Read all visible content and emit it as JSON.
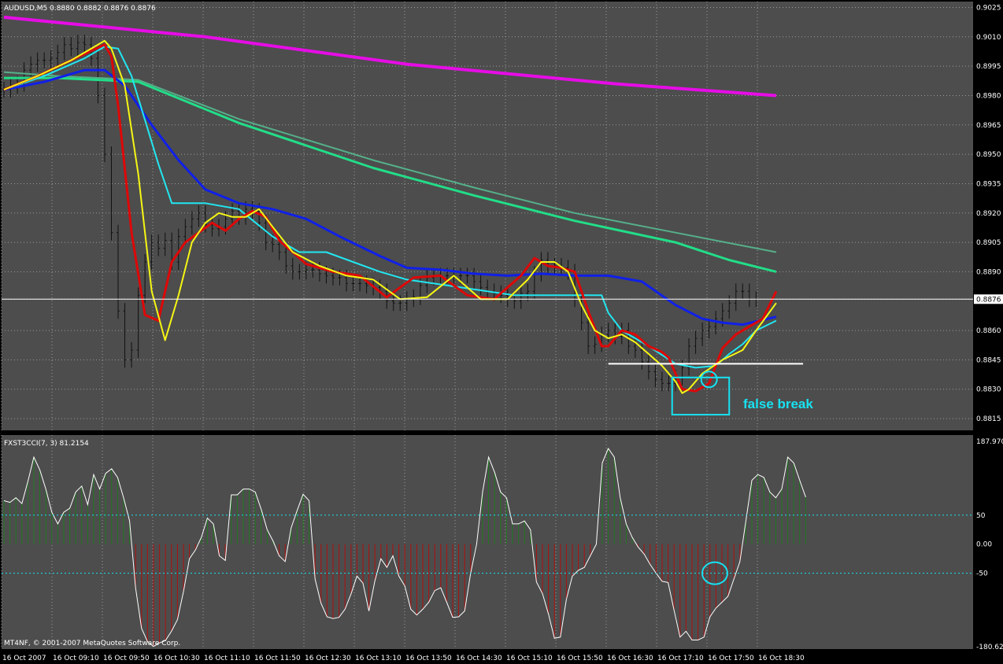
{
  "colors": {
    "background": "#4d4d4d",
    "frame": "#000000",
    "grid": "#9a9a9a",
    "text": "#ffffff",
    "bull_hist": "#1f7a1f",
    "bear_hist": "#b01010",
    "annotation": "#17e2f2",
    "ma_magenta": "#e60ce6",
    "ma_green": "#22dd88",
    "ma_green_thin": "#55b08a",
    "ma_blue": "#1020e8",
    "ma_cyan": "#22e6f0",
    "ma_red": "#dd0808",
    "ma_yellow": "#f6f614"
  },
  "chart_data": [
    {
      "type": "line",
      "header": "AUDUSD,M5  0.8880 0.8882 0.8876 0.8876",
      "symbol": "AUDUSD",
      "timeframe": "M5",
      "ylim": [
        0.8809,
        0.9028
      ],
      "y_ticks": [
        "0.9025",
        "0.9010",
        "0.8995",
        "0.8980",
        "0.8965",
        "0.8950",
        "0.8935",
        "0.8920",
        "0.8905",
        "0.8890",
        "0.8876",
        "0.8860",
        "0.8845",
        "0.8830",
        "0.8815"
      ],
      "current_price": "0.8876",
      "bar_count": 117,
      "close": [
        0.8983,
        0.8985,
        0.8986,
        0.8993,
        0.8996,
        0.8998,
        0.8998,
        0.8999,
        0.9002,
        0.9006,
        0.9004,
        0.9007,
        0.9006,
        0.8999,
        0.898,
        0.895,
        0.891,
        0.887,
        0.8845,
        0.885,
        0.8878,
        0.8895,
        0.8905,
        0.8902,
        0.8906,
        0.8895,
        0.8908,
        0.8913,
        0.8917,
        0.892,
        0.8914,
        0.8912,
        0.8913,
        0.8917,
        0.8921,
        0.8918,
        0.8922,
        0.8921,
        0.8915,
        0.8905,
        0.8904,
        0.89,
        0.8893,
        0.889,
        0.889,
        0.8891,
        0.8891,
        0.8889,
        0.8888,
        0.8887,
        0.8887,
        0.8884,
        0.8884,
        0.8884,
        0.8883,
        0.8882,
        0.888,
        0.8875,
        0.8874,
        0.8874,
        0.8876,
        0.8877,
        0.8883,
        0.8887,
        0.8888,
        0.8888,
        0.8888,
        0.8888,
        0.8888,
        0.8888,
        0.8885,
        0.8882,
        0.888,
        0.8879,
        0.8878,
        0.8876,
        0.8875,
        0.8879,
        0.888,
        0.8889,
        0.8896,
        0.8893,
        0.8893,
        0.8892,
        0.889,
        0.8876,
        0.8864,
        0.8852,
        0.8853,
        0.8858,
        0.886,
        0.8857,
        0.886,
        0.8852,
        0.885,
        0.8844,
        0.8839,
        0.8835,
        0.8833,
        0.8833,
        0.8836,
        0.8841,
        0.8852,
        0.8856,
        0.886,
        0.8862,
        0.8866,
        0.887,
        0.8874,
        0.888,
        0.888,
        0.8876,
        0.8876
      ],
      "series": [
        {
          "color_key": "ma_magenta",
          "x": [
            0,
            12,
            30,
            60,
            91,
            115
          ],
          "y": [
            0.902,
            0.9016,
            0.901,
            0.8996,
            0.8986,
            0.898
          ]
        },
        {
          "color_key": "ma_green_thin",
          "x": [
            0,
            8,
            20,
            35,
            55,
            70,
            85,
            100,
            115
          ],
          "y": [
            0.8992,
            0.899,
            0.8988,
            0.8968,
            0.8947,
            0.8933,
            0.892,
            0.891,
            0.89
          ]
        },
        {
          "color_key": "ma_green",
          "x": [
            0,
            8,
            20,
            35,
            55,
            70,
            85,
            100,
            108,
            115
          ],
          "y": [
            0.8989,
            0.8989,
            0.8987,
            0.8966,
            0.8943,
            0.8929,
            0.8916,
            0.8905,
            0.8896,
            0.889
          ]
        },
        {
          "color_key": "ma_blue",
          "x": [
            0,
            6,
            12,
            15,
            18,
            22,
            26,
            30,
            35,
            40,
            45,
            50,
            56,
            60,
            65,
            70,
            75,
            80,
            85,
            90,
            95,
            100,
            104,
            107,
            110,
            115
          ],
          "y": [
            0.8983,
            0.8987,
            0.8993,
            0.8993,
            0.8985,
            0.8965,
            0.8947,
            0.8932,
            0.8925,
            0.8922,
            0.8917,
            0.8908,
            0.8898,
            0.8892,
            0.8891,
            0.8889,
            0.8888,
            0.8889,
            0.8888,
            0.8888,
            0.8885,
            0.8873,
            0.8866,
            0.8864,
            0.8863,
            0.8867
          ]
        },
        {
          "color_key": "ma_cyan",
          "x": [
            0,
            6,
            12,
            15,
            17,
            19,
            23,
            25,
            30,
            35,
            40,
            44,
            48,
            52,
            56,
            60,
            66,
            70,
            76,
            80,
            86,
            89,
            90,
            92,
            96,
            100,
            103,
            106,
            108,
            110,
            112,
            115
          ],
          "y": [
            0.8983,
            0.899,
            0.8999,
            0.9005,
            0.9004,
            0.899,
            0.8945,
            0.8925,
            0.8925,
            0.8922,
            0.8908,
            0.89,
            0.89,
            0.8895,
            0.889,
            0.8886,
            0.8883,
            0.8881,
            0.8878,
            0.8878,
            0.8878,
            0.8878,
            0.8869,
            0.886,
            0.8852,
            0.8843,
            0.8841,
            0.8842,
            0.8848,
            0.8853,
            0.886,
            0.8865
          ]
        },
        {
          "color_key": "ma_red",
          "x": [
            0,
            5,
            10,
            15,
            16,
            17,
            19,
            21,
            23,
            25,
            27,
            29,
            31,
            33,
            35,
            37,
            39,
            41,
            45,
            49,
            53,
            57,
            61,
            65,
            69,
            73,
            77,
            79,
            81,
            83,
            85,
            87,
            89,
            90,
            92,
            94,
            96,
            98,
            99,
            100,
            101,
            103,
            105,
            107,
            109,
            111,
            113,
            115
          ],
          "y": [
            0.8983,
            0.899,
            0.8998,
            0.9006,
            0.9,
            0.8975,
            0.891,
            0.8868,
            0.8865,
            0.8895,
            0.8905,
            0.891,
            0.8915,
            0.8911,
            0.8917,
            0.8921,
            0.8918,
            0.8906,
            0.8894,
            0.889,
            0.8888,
            0.8877,
            0.8887,
            0.8888,
            0.8878,
            0.8876,
            0.8888,
            0.8897,
            0.8893,
            0.8892,
            0.889,
            0.887,
            0.8852,
            0.8852,
            0.886,
            0.8858,
            0.8852,
            0.8849,
            0.8846,
            0.8838,
            0.883,
            0.8829,
            0.8833,
            0.8851,
            0.8858,
            0.8862,
            0.8866,
            0.888
          ]
        },
        {
          "color_key": "ma_yellow",
          "x": [
            0,
            5,
            10,
            15,
            16,
            18,
            20,
            22,
            24,
            26,
            28,
            30,
            32,
            34,
            36,
            38,
            40,
            43,
            47,
            51,
            55,
            59,
            63,
            67,
            71,
            75,
            78,
            80,
            82,
            84,
            86,
            88,
            90,
            92,
            94,
            96,
            98,
            100,
            101,
            102,
            104,
            107,
            110,
            112,
            115
          ],
          "y": [
            0.8983,
            0.899,
            0.8998,
            0.9008,
            0.9004,
            0.8985,
            0.894,
            0.888,
            0.8855,
            0.8878,
            0.8905,
            0.8915,
            0.892,
            0.8918,
            0.8918,
            0.8922,
            0.8913,
            0.89,
            0.8893,
            0.8888,
            0.8886,
            0.8876,
            0.8877,
            0.8888,
            0.8876,
            0.8876,
            0.8886,
            0.8895,
            0.8895,
            0.889,
            0.8873,
            0.886,
            0.8856,
            0.8858,
            0.8854,
            0.8848,
            0.8842,
            0.8834,
            0.8828,
            0.883,
            0.8838,
            0.8845,
            0.885,
            0.886,
            0.8874
          ]
        }
      ],
      "level_line": {
        "x0": 90,
        "x1": 119,
        "y": 0.8843
      },
      "box_highlight": {
        "x0": 99.5,
        "x1": 108,
        "y0": 0.8817,
        "y1": 0.8836
      },
      "circle_highlight": {
        "x": 105,
        "y": 0.8835
      },
      "annotation": "false break"
    },
    {
      "type": "area",
      "header": "FXST3CCI(7, 3) 81.2154",
      "ylim": [
        -180.628,
        187.97
      ],
      "y_ticks": [
        "187.970",
        "50",
        "0.00",
        "-50",
        "-180.628"
      ],
      "levels": [
        50,
        -50
      ],
      "values": [
        75,
        72,
        80,
        70,
        108,
        150,
        128,
        95,
        55,
        35,
        55,
        62,
        90,
        100,
        68,
        120,
        95,
        122,
        130,
        115,
        80,
        40,
        -75,
        -145,
        -168,
        -176,
        -170,
        -166,
        -150,
        -130,
        -82,
        -25,
        -10,
        12,
        45,
        35,
        -20,
        -28,
        85,
        85,
        95,
        95,
        90,
        60,
        25,
        5,
        -20,
        -30,
        28,
        58,
        86,
        75,
        -60,
        -102,
        -125,
        -128,
        -126,
        -112,
        -86,
        -55,
        -67,
        -115,
        -63,
        -25,
        -40,
        -20,
        -55,
        -72,
        -112,
        -122,
        -112,
        -100,
        -80,
        -75,
        -100,
        -126,
        -125,
        -115,
        -50,
        0,
        90,
        150,
        124,
        90,
        80,
        35,
        35,
        40,
        25,
        -65,
        -85,
        -120,
        -162,
        -160,
        -95,
        -55,
        -45,
        -40,
        -20,
        0,
        140,
        165,
        150,
        80,
        35,
        12,
        -5,
        -17,
        -35,
        -50,
        -64,
        -66,
        -114,
        -160,
        -150,
        -165,
        -165,
        -160,
        -125,
        -110,
        -100,
        -90,
        -60,
        -30,
        40,
        110,
        120,
        115,
        90,
        80,
        95,
        150,
        140,
        110,
        81
      ]
    }
  ],
  "x_axis_labels": [
    "16 Oct 2007",
    "16 Oct 09:10",
    "16 Oct 09:50",
    "16 Oct 10:30",
    "16 Oct 11:10",
    "16 Oct 11:50",
    "16 Oct 12:30",
    "16 Oct 13:10",
    "16 Oct 13:50",
    "16 Oct 14:30",
    "16 Oct 15:10",
    "16 Oct 15:50",
    "16 Oct 16:30",
    "16 Oct 17:10",
    "16 Oct 17:50",
    "16 Oct 18:30"
  ],
  "copyright": "MT4NF, © 2001-2007 MetaQuotes Software Corp."
}
